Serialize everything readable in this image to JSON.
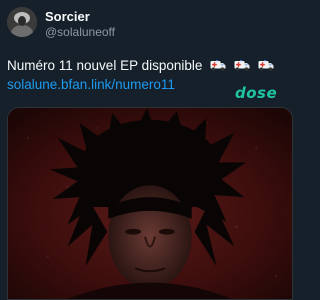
{
  "author": {
    "display_name": "Sorcier",
    "handle": "@solaluneoff"
  },
  "tweet": {
    "text": "Numéro 11 nouvel EP disponible",
    "emoji_icons": [
      "ambulance-icon",
      "ambulance-icon",
      "ambulance-icon"
    ],
    "link": "solalune.bfan.link/numero11"
  },
  "card": {
    "brand_logo_text": "dose"
  },
  "colors": {
    "background": "#15202b",
    "text": "#f7f9f9",
    "secondary_text": "#8b98a5",
    "link": "#1d9bf0",
    "brand": "#1fc5a0"
  }
}
